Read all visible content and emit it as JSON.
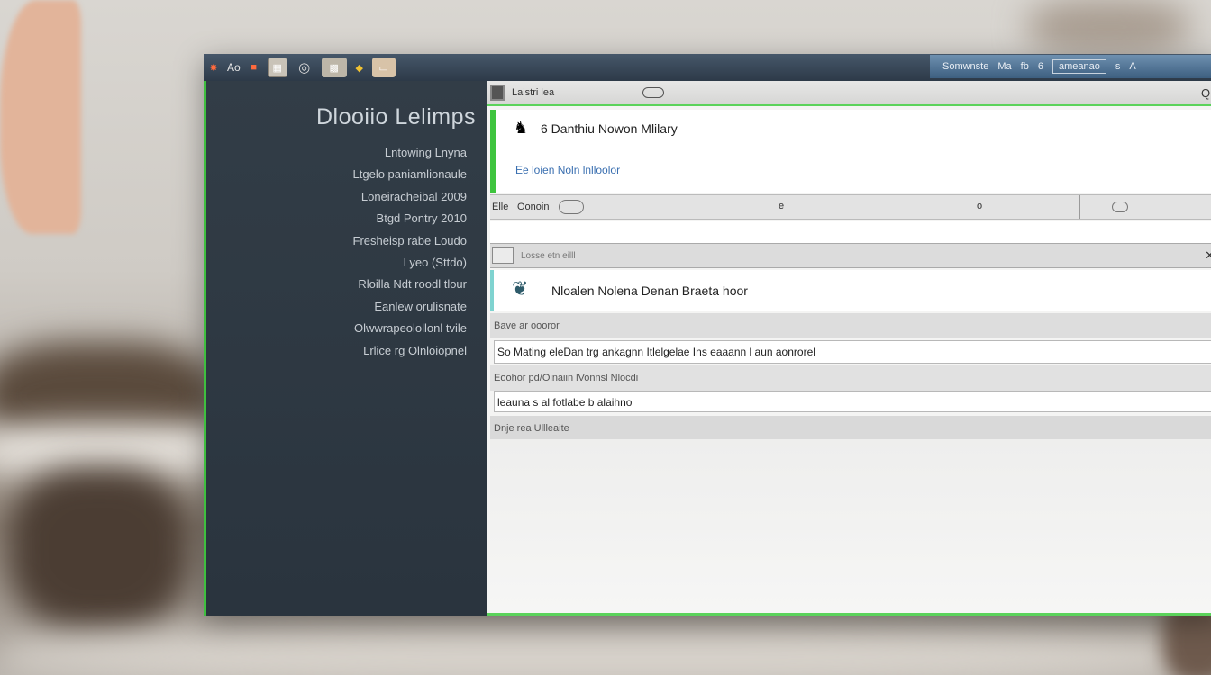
{
  "taskbar": {
    "app_label": "Ao",
    "tray_label": "Somwnste",
    "tray_item_1": "Ma",
    "tray_item_2": "fb",
    "tray_item_3": "6",
    "tray_box": "ameanao",
    "tray_item_4": "s",
    "tray_item_5": "A"
  },
  "sidebar": {
    "title": "Dlooiio   Lelimps",
    "items": [
      "Lntowing  Lnyna",
      "Ltgelo paniamlionaule",
      "Loneiracheibal 2009",
      "Btgd Pontry 2010",
      "Fresheisp rabe Loudo",
      "Lyeo (Sttdo)",
      "Rloilla Ndt roodl tlour",
      "Eanlew orulisnate",
      "Olwwrapeolollonl tvile",
      "Lrlice rg   Olnloiopnel"
    ]
  },
  "content": {
    "titlebar_label": "Laistri lea",
    "corner_label": "Ql",
    "contact_name": "6 Danthiu Nowon Mlilary",
    "contact_sub": "Ee loien Noln lnlloolor",
    "tab_1": "Elle",
    "tab_2": "Oonoin",
    "tab_dot_1": "e",
    "tab_dot_2": "o",
    "section_label": "Losse etn eilll",
    "close_label": "✕",
    "doc_title": "Nloalen Nolena Denan Braeta hoor",
    "section_1": "Bave ar oooror",
    "field_1": "So Mating eleDan trg ankagnn Itlelgelae Ins eaaann l aun aonrorel",
    "section_2": "Eoohor pd/Oinaiin lVonnsl Nlocdi",
    "field_2": "leauna s al fotlabe b alaihno",
    "section_3": "Dnje rea Ullleaite"
  },
  "colors": {
    "accent_green": "#3fbf3f",
    "sidebar_bg": "#2f3943",
    "link_blue": "#3a6fb0"
  }
}
